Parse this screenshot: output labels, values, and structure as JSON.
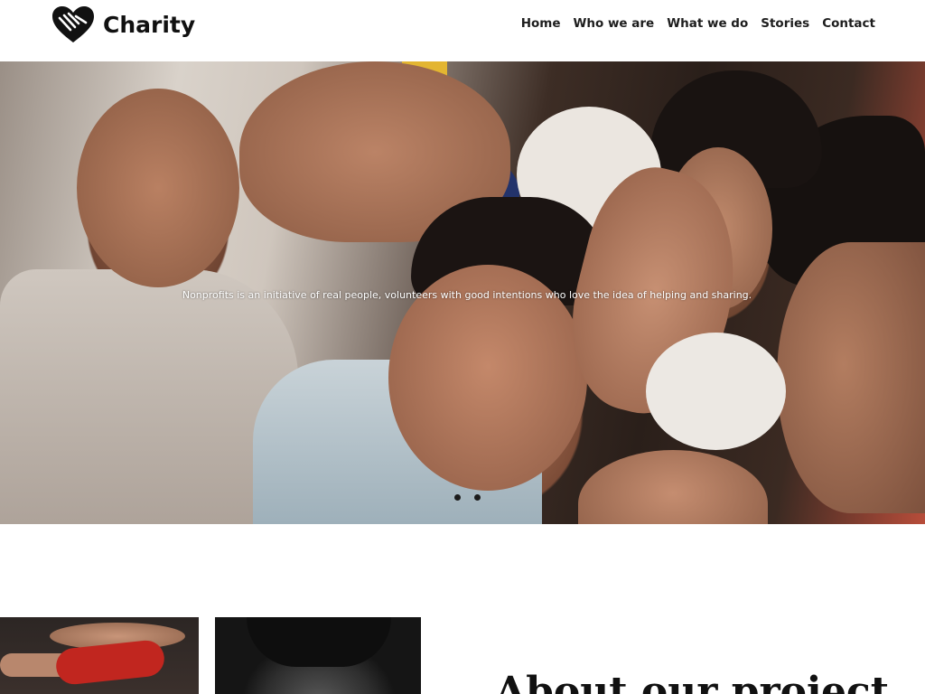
{
  "header": {
    "brand": "Charity",
    "logo_icon": "heart-hands-icon",
    "nav": [
      {
        "label": "Home"
      },
      {
        "label": "Who we are"
      },
      {
        "label": "What we do"
      },
      {
        "label": "Stories"
      },
      {
        "label": "Contact"
      }
    ]
  },
  "hero": {
    "tagline": "Nonprofits is an initiative of real people, volunteers with good intentions who love the idea of helping and sharing.",
    "slides_count": 2,
    "active_slide": 1
  },
  "about": {
    "title": "About our project"
  },
  "colors": {
    "text": "#111111",
    "background": "#ffffff",
    "dot": "#1c1c1c"
  }
}
